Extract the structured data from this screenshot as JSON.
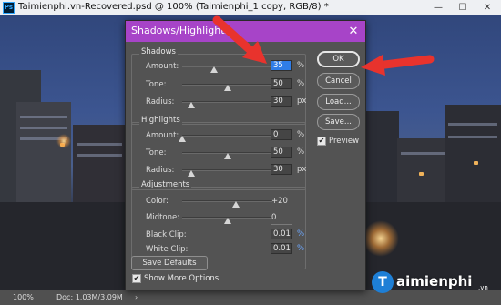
{
  "document": {
    "title": "Taimienphi.vn-Recovered.psd @ 100% (Taimienphi_1 copy, RGB/8) *",
    "app_icon_text": "Ps",
    "minimize": "—",
    "maximize": "☐",
    "close": "✕"
  },
  "status_bar": {
    "zoom": "100%",
    "doc_info": "Doc: 1,03M/3,09M",
    "arrow": "›"
  },
  "dialog": {
    "title": "Shadows/Highlights",
    "close": "✕",
    "shadows": {
      "label": "Shadows",
      "amount": {
        "label": "Amount:",
        "value": "35",
        "unit": "%",
        "slider": 0.35
      },
      "tone": {
        "label": "Tone:",
        "value": "50",
        "unit": "%",
        "slider": 0.5
      },
      "radius": {
        "label": "Radius:",
        "value": "30",
        "unit": "px",
        "slider": 0.1
      }
    },
    "highlights": {
      "label": "Highlights",
      "amount": {
        "label": "Amount:",
        "value": "0",
        "unit": "%",
        "slider": 0.0
      },
      "tone": {
        "label": "Tone:",
        "value": "50",
        "unit": "%",
        "slider": 0.5
      },
      "radius": {
        "label": "Radius:",
        "value": "30",
        "unit": "px",
        "slider": 0.1
      }
    },
    "adjustments": {
      "label": "Adjustments",
      "color": {
        "label": "Color:",
        "value": "+20",
        "slider": 0.6
      },
      "midtone": {
        "label": "Midtone:",
        "value": "0",
        "slider": 0.5
      },
      "black_clip": {
        "label": "Black Clip:",
        "value": "0.01",
        "unit": "%"
      },
      "white_clip": {
        "label": "White Clip:",
        "value": "0.01",
        "unit": "%"
      }
    },
    "buttons": {
      "ok": "OK",
      "cancel": "Cancel",
      "load": "Load...",
      "save": "Save..."
    },
    "preview": {
      "label": "Preview",
      "checked": true,
      "mark": "✔"
    },
    "save_defaults": "Save Defaults",
    "show_more_options": {
      "label": "Show More Options",
      "checked": true,
      "mark": "✔"
    }
  },
  "watermark": {
    "letter": "T",
    "name": "aimienphi",
    "suffix": ".vn"
  },
  "colors": {
    "dialog_title_bar": "#a744c8",
    "arrow_red": "#e8332d",
    "selection_blue": "#2f7de8"
  }
}
